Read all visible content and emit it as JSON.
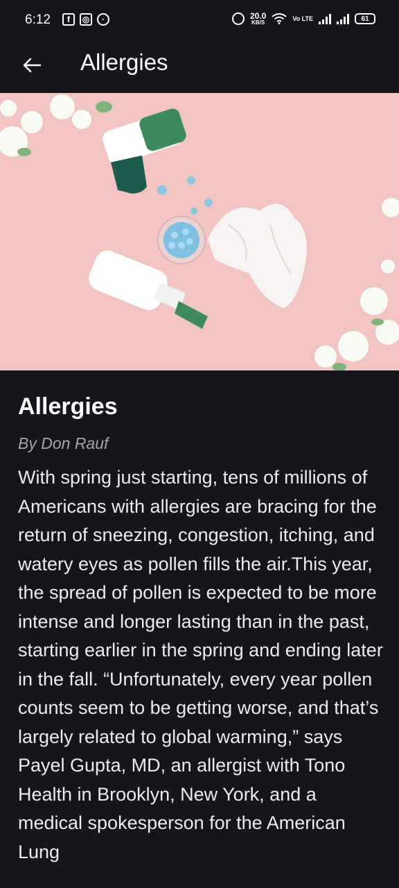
{
  "status_bar": {
    "time": "6:12",
    "net_speed_value": "20.0",
    "net_speed_unit": "KB/S",
    "volte_label": "Vo LTE",
    "battery": "61"
  },
  "app_bar": {
    "title": "Allergies",
    "back_icon": "arrow-left-icon"
  },
  "article": {
    "title": "Allergies",
    "author": "By Don Rauf",
    "body": "With spring just starting, tens of millions of Americans with allergies are bracing for the return of sneezing, congestion, itching, and watery eyes as pollen fills the air.This year, the spread of pollen is expected to be more intense and longer lasting than in the past, starting earlier in the spring and ending later in the fall. “Unfortunately, every year pollen counts seem to be getting worse, and that’s largely related to global warming,” says Payel Gupta, MD, an allergist with Tono Health in Brooklyn, New York, and a medical spokesperson for the American Lung"
  },
  "colors": {
    "background": "#17141b",
    "hero_background": "#f2c4c2",
    "accent_green": "#3e8a5c",
    "author_gray": "#a7a4ab"
  }
}
